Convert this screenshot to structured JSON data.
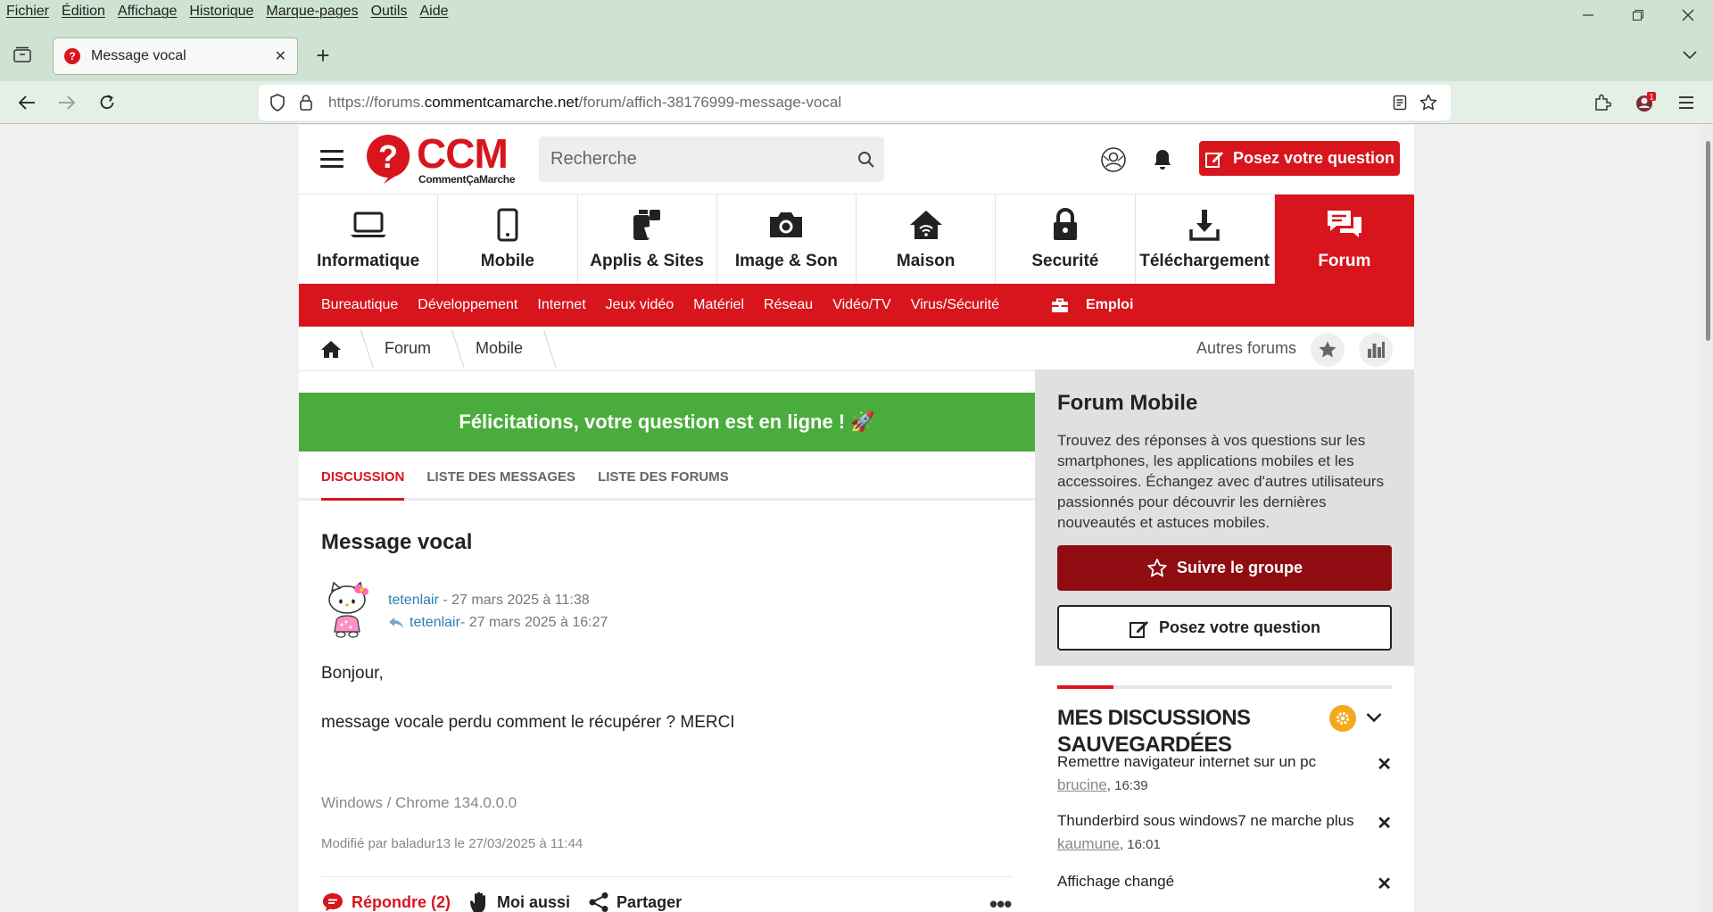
{
  "browser": {
    "menu": [
      "Fichier",
      "Édition",
      "Affichage",
      "Historique",
      "Marque-pages",
      "Outils",
      "Aide"
    ],
    "tab_title": "Message vocal",
    "url_prefix": "https://forums.",
    "url_domain": "commentcamarche.net",
    "url_path": "/forum/affich-38176999-message-vocal"
  },
  "header": {
    "logo_text": "CCM",
    "logo_sub": "CommentÇaMarche",
    "search_placeholder": "Recherche",
    "ask_label": "Posez votre question"
  },
  "categories": [
    {
      "label": "Informatique",
      "icon": "laptop-icon"
    },
    {
      "label": "Mobile",
      "icon": "phone-icon"
    },
    {
      "label": "Applis & Sites",
      "icon": "apps-icon"
    },
    {
      "label": "Image & Son",
      "icon": "camera-icon"
    },
    {
      "label": "Maison",
      "icon": "home-wifi-icon"
    },
    {
      "label": "Securité",
      "icon": "lock-icon"
    },
    {
      "label": "Téléchargement",
      "icon": "download-icon"
    },
    {
      "label": "Forum",
      "icon": "forum-icon"
    }
  ],
  "subnav": [
    "Bureautique",
    "Développement",
    "Internet",
    "Jeux vidéo",
    "Matériel",
    "Réseau",
    "Vidéo/TV",
    "Virus/Sécurité"
  ],
  "subnav_emploi": "Emploi",
  "breadcrumb": {
    "forum": "Forum",
    "mobile": "Mobile",
    "other": "Autres forums"
  },
  "banner": "Félicitations, votre question est en ligne ! 🚀",
  "tabs": [
    "Discussion",
    "Liste des messages",
    "Liste des forums"
  ],
  "post": {
    "title": "Message vocal",
    "author": "tetenlair",
    "date": " - 27 mars 2025 à 11:38",
    "reply_author": "tetenlair",
    "reply_date": " - 27 mars 2025 à 16:27",
    "greeting": "Bonjour,",
    "text": "message vocale perdu comment le récupérer ? MERCI",
    "config": "Windows / Chrome 134.0.0.0",
    "modified": "Modifié par baladur13 le 27/03/2025 à 11:44",
    "reply_label": "Répondre (2)",
    "metoo_label": "Moi aussi",
    "share_label": "Partager",
    "more": "•••"
  },
  "sidebar": {
    "title": "Forum Mobile",
    "description": "Trouvez des réponses à vos questions sur les smartphones, les applications mobiles et les accessoires. Échangez avec d'autres utilisateurs passionnés pour découvrir les dernières nouveautés et astuces mobiles.",
    "follow_label": "Suivre le groupe",
    "ask_label": "Posez votre question",
    "saved_title": "MES DISCUSSIONS SAUVEGARDÉES",
    "discussions": [
      {
        "title": "Remettre navigateur internet sur un pc",
        "user": "brucine",
        "time": ", 16:39"
      },
      {
        "title": "Thunderbird sous windows7 ne marche plus",
        "user": "kaumune",
        "time": ", 16:01"
      },
      {
        "title": "Affichage changé",
        "user": "",
        "time": ""
      }
    ]
  },
  "colors": {
    "brand_red": "#d8151d",
    "success_green": "#4aac3c",
    "dark_red": "#8f0d12",
    "link_blue": "#2d7db3"
  }
}
